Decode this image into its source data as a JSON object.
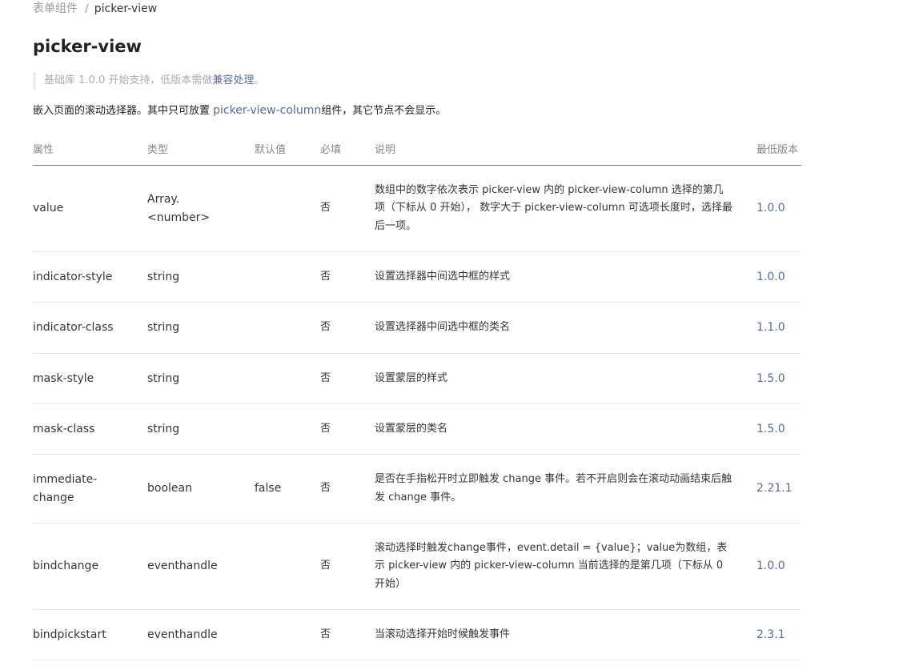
{
  "breadcrumb": {
    "parent": "表单组件",
    "separator": "/",
    "current": "picker-view"
  },
  "title": "picker-view",
  "notice": {
    "prefix": "基础库 1.0.0 开始支持，低版本需做",
    "link": "兼容处理",
    "suffix": "。"
  },
  "intro": {
    "prefix": "嵌入页面的滚动选择器。其中只可放置 ",
    "link": "picker-view-column",
    "suffix": "组件，其它节点不会显示。"
  },
  "table": {
    "headers": [
      "属性",
      "类型",
      "默认值",
      "必填",
      "说明",
      "最低版本"
    ],
    "rows": [
      {
        "attr": "value",
        "type": "Array.<number>",
        "default": "",
        "required": "否",
        "desc": "数组中的数字依次表示 picker-view 内的 picker-view-column 选择的第几项（下标从 0 开始）， 数字大于 picker-view-column 可选项长度时，选择最后一项。",
        "version": "1.0.0"
      },
      {
        "attr": "indicator-style",
        "type": "string",
        "default": "",
        "required": "否",
        "desc": "设置选择器中间选中框的样式",
        "version": "1.0.0"
      },
      {
        "attr": "indicator-class",
        "type": "string",
        "default": "",
        "required": "否",
        "desc": "设置选择器中间选中框的类名",
        "version": "1.1.0"
      },
      {
        "attr": "mask-style",
        "type": "string",
        "default": "",
        "required": "否",
        "desc": "设置蒙层的样式",
        "version": "1.5.0"
      },
      {
        "attr": "mask-class",
        "type": "string",
        "default": "",
        "required": "否",
        "desc": "设置蒙层的类名",
        "version": "1.5.0"
      },
      {
        "attr": "immediate-change",
        "type": "boolean",
        "default": "false",
        "required": "否",
        "desc": "是否在手指松开时立即触发 change 事件。若不开启则会在滚动动画结束后触发 change 事件。",
        "version": "2.21.1"
      },
      {
        "attr": "bindchange",
        "type": "eventhandle",
        "default": "",
        "required": "否",
        "desc": "滚动选择时触发change事件，event.detail = {value}；value为数组，表示 picker-view 内的 picker-view-column 当前选择的是第几项（下标从 0 开始）",
        "version": "1.0.0"
      },
      {
        "attr": "bindpickstart",
        "type": "eventhandle",
        "default": "",
        "required": "否",
        "desc": "当滚动选择开始时候触发事件",
        "version": "2.3.1"
      }
    ]
  }
}
